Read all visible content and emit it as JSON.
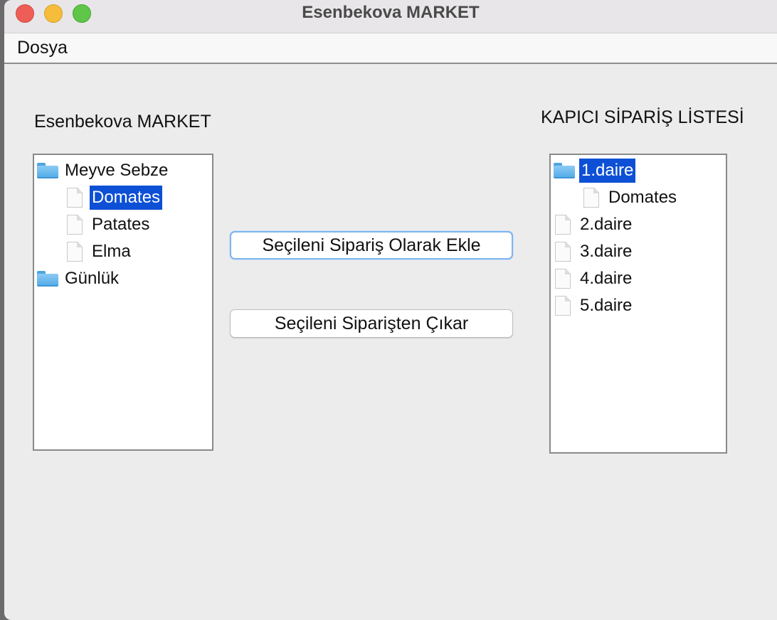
{
  "window": {
    "title": "Esenbekova MARKET"
  },
  "menubar": {
    "items": [
      {
        "label": "Dosya"
      }
    ]
  },
  "left_panel": {
    "heading": "Esenbekova MARKET",
    "tree": {
      "folder1": "Meyve Sebze",
      "item1": "Domates",
      "item2": "Patates",
      "item3": "Elma",
      "folder2": "Günlük",
      "selected": "Domates"
    }
  },
  "buttons": {
    "add_label": "Seçileni Sipariş Olarak Ekle",
    "remove_label": "Seçileni Siparişten Çıkar"
  },
  "right_panel": {
    "heading": "KAPICI SİPARİŞ LİSTESİ",
    "tree": {
      "folder1": "1.daire",
      "child1": "Domates",
      "item2": "2.daire",
      "item3": "3.daire",
      "item4": "4.daire",
      "item5": "5.daire",
      "selected": "1.daire"
    }
  },
  "colors": {
    "selection": "#0d50d6",
    "folder": "#55ade8",
    "window_bg": "#ececec"
  }
}
